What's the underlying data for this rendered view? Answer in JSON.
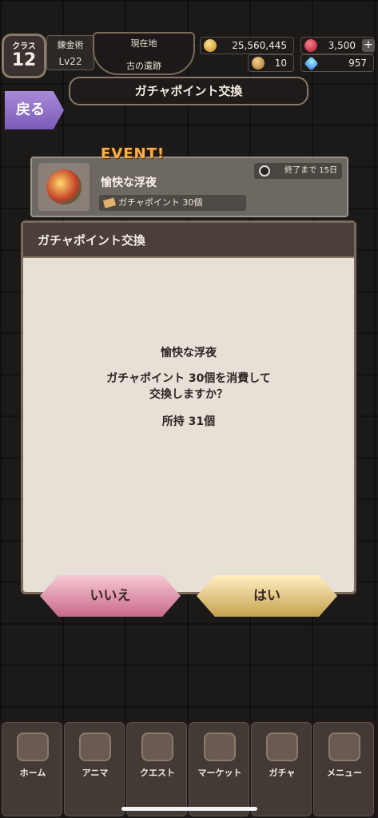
{
  "header": {
    "class_label": "クラス",
    "class_level": "12",
    "job": "錬金術",
    "level": "Lv22",
    "location_label": "現在地",
    "location": "古の遺跡",
    "gold": "25,560,445",
    "rubies": "3,500",
    "bread": "10",
    "gems": "957"
  },
  "title": "ガチャポイント交換",
  "back_label": "戻る",
  "event": {
    "tag": "EVENT!",
    "name": "愉快な浮夜",
    "cost": "ガチャポイント 30個",
    "deadline": "終了まで 15日"
  },
  "dialog": {
    "heading": "ガチャポイント交換",
    "item": "愉快な浮夜",
    "line1": "ガチャポイント 30個を消費して",
    "line2": "交換しますか？",
    "owned": "所持 31個",
    "no": "いいえ",
    "yes": "はい"
  },
  "nav": [
    {
      "label": "ホーム",
      "icon": "home-icon"
    },
    {
      "label": "アニマ",
      "icon": "anima-icon"
    },
    {
      "label": "クエスト",
      "icon": "quest-icon"
    },
    {
      "label": "マーケット",
      "icon": "market-icon"
    },
    {
      "label": "ガチャ",
      "icon": "gacha-icon"
    },
    {
      "label": "メニュー",
      "icon": "menu-icon"
    }
  ],
  "colors": {
    "back_button": "#8f6fc8",
    "event_tag": "#f5b24c",
    "no_button": "#e39ab0",
    "yes_button": "#e6c97a"
  }
}
